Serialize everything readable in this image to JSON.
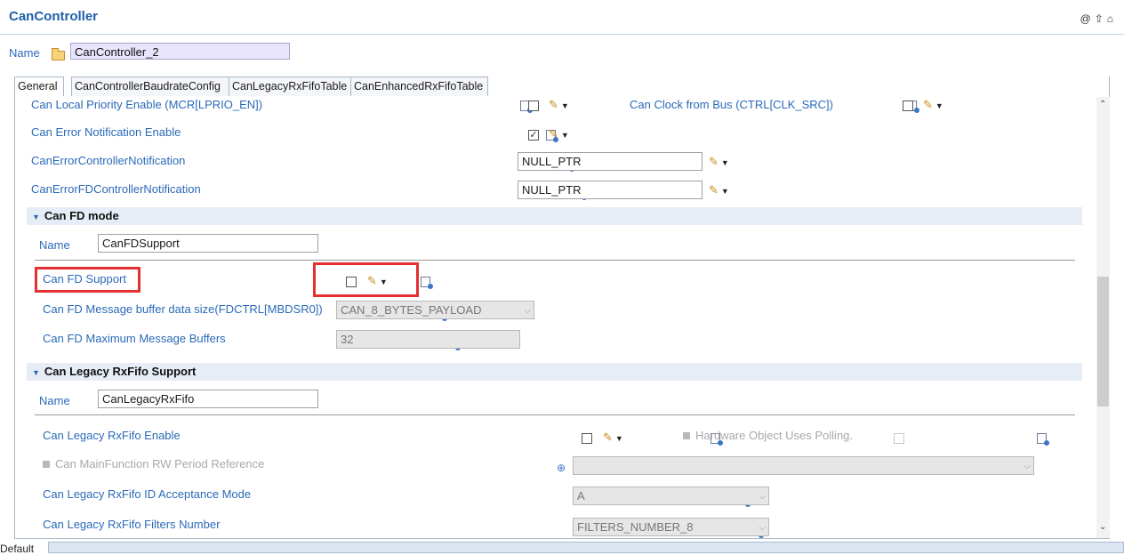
{
  "header": {
    "title": "CanController"
  },
  "top_icons": [
    "at-icon",
    "up-arrow-icon",
    "home-icon"
  ],
  "name_field": {
    "label": "Name",
    "value": "CanController_2"
  },
  "tabs": [
    {
      "label": "General",
      "active": true
    },
    {
      "label": "CanControllerBaudrateConfig",
      "active": false
    },
    {
      "label": "CanLegacyRxFifoTable",
      "active": false
    },
    {
      "label": "CanEnhancedRxFifoTable",
      "active": false
    }
  ],
  "general_rows": {
    "local_priority": {
      "label": "Can Local Priority Enable (MCR[LPRIO_EN])",
      "checked": false
    },
    "clock_from_bus": {
      "label": "Can Clock from Bus (CTRL[CLK_SRC])",
      "checked": false
    },
    "error_notification": {
      "label": "Can Error Notification Enable",
      "checked": true,
      "check_mark": "✓"
    },
    "error_ctrl_notification": {
      "label": "CanErrorControllerNotification",
      "value": "NULL_PTR"
    },
    "error_fd_ctrl_notification": {
      "label": "CanErrorFDControllerNotification",
      "value": "NULL_PTR"
    }
  },
  "fd_section": {
    "title": "Can FD mode",
    "name_label": "Name",
    "name_value": "CanFDSupport",
    "fd_support": {
      "label": "Can FD Support",
      "checked": false
    },
    "mb_data_size": {
      "label": "Can FD Message buffer data size(FDCTRL[MBDSR0])",
      "value": "CAN_8_BYTES_PAYLOAD"
    },
    "max_mb": {
      "label": "Can FD Maximum Message Buffers",
      "value": "32"
    }
  },
  "legacy_section": {
    "title": "Can Legacy RxFifo Support",
    "name_label": "Name",
    "name_value": "CanLegacyRxFifo",
    "enable": {
      "label": "Can Legacy RxFifo Enable",
      "checked": false
    },
    "hw_polling": {
      "label": "Hardware Object Uses Polling."
    },
    "mainfunction": {
      "label": "Can MainFunction RW Period Reference",
      "value": ""
    },
    "id_acceptance": {
      "label": "Can Legacy RxFifo ID Acceptance Mode",
      "value": "A"
    },
    "filters_number": {
      "label": "Can Legacy RxFifo Filters Number",
      "value": "FILTERS_NUMBER_8"
    }
  },
  "footer": {
    "tab_label": "Default"
  },
  "colors": {
    "accent": "#2a6ab8",
    "highlight": "#e53030",
    "section_bg": "#e6edf6"
  }
}
